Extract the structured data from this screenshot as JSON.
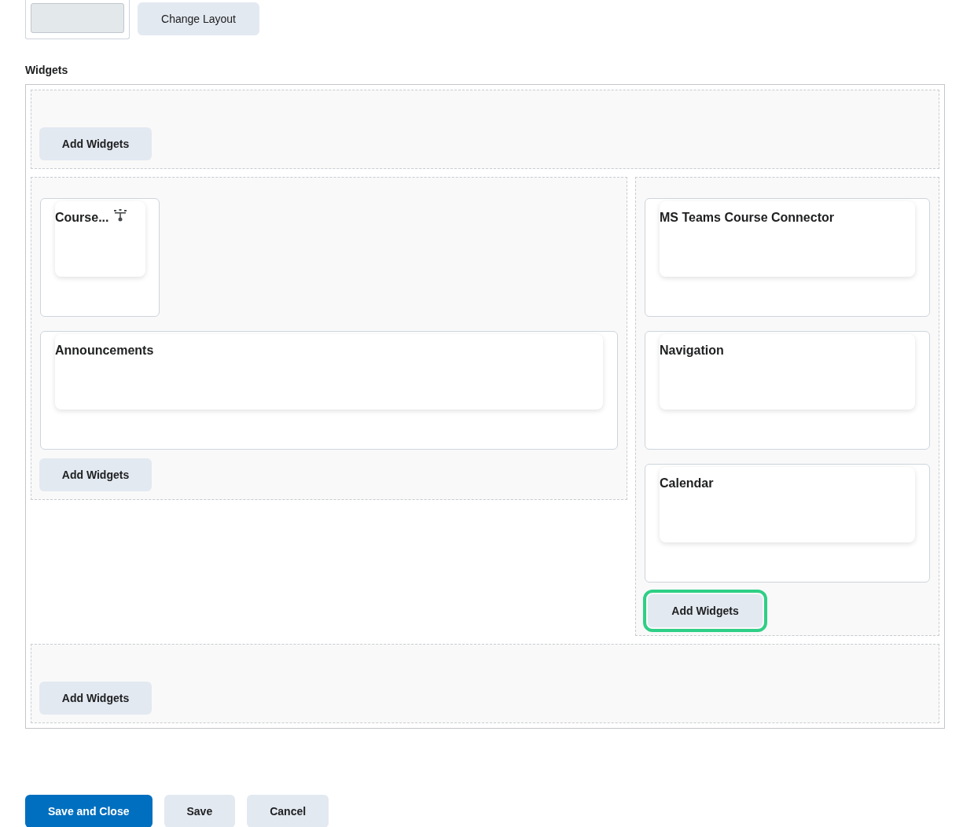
{
  "layout_button": {
    "label": "Change Layout"
  },
  "section_label": "Widgets",
  "regions": [
    {
      "kind": "full",
      "add_button": {
        "label": "Add Widgets",
        "focused": false
      }
    },
    {
      "kind": "left",
      "widgets": [
        {
          "kind": "compact",
          "title": "Course..."
        },
        {
          "kind": "wide",
          "title": "Announcements"
        }
      ],
      "add_button": {
        "label": "Add Widgets",
        "focused": false
      }
    },
    {
      "kind": "right",
      "widgets": [
        {
          "kind": "wide",
          "title": "MS Teams Course Connector"
        },
        {
          "kind": "wide",
          "title": "Navigation"
        },
        {
          "kind": "wide",
          "title": "Calendar"
        }
      ],
      "add_button": {
        "label": "Add Widgets",
        "focused": true
      }
    },
    {
      "kind": "full",
      "add_button": {
        "label": "Add Widgets",
        "focused": false
      }
    }
  ],
  "footer_buttons": [
    {
      "label": "Save and Close",
      "kind": "primary"
    },
    {
      "label": "Save",
      "kind": "secondary"
    },
    {
      "label": "Cancel",
      "kind": "secondary"
    }
  ]
}
